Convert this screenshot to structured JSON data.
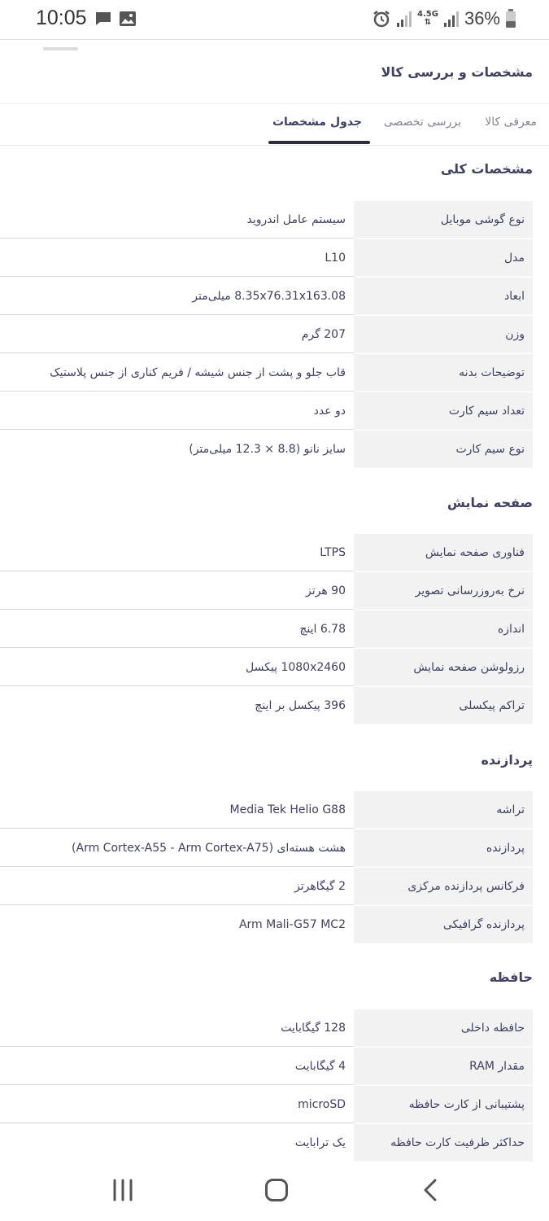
{
  "status_bar": {
    "time": "10:05",
    "network": "4.5G",
    "battery": "36%",
    "icons": [
      "message-icon",
      "image-icon",
      "alarm-icon",
      "wifi-signal-icon",
      "cell-signal-icon",
      "battery-icon"
    ]
  },
  "header": {
    "title": "مشخصات و بررسی کالا"
  },
  "tabs": [
    {
      "label": "معرفی کالا"
    },
    {
      "label": "بررسی تخصصی"
    },
    {
      "label": "جدول مشخصات"
    }
  ],
  "sections": [
    {
      "title": "مشخصات کلی",
      "rows": [
        {
          "key": "نوع گوشی موبایل",
          "value": "سیستم عامل اندروید"
        },
        {
          "key": "مدل",
          "value": "L10"
        },
        {
          "key": "ابعاد",
          "value": "8.35x76.31x163.08 میلی‌متر"
        },
        {
          "key": "وزن",
          "value": "207 گرم"
        },
        {
          "key": "توضیحات بدنه",
          "value": "قاب جلو و پشت از جنس شیشه / فریم کناری از جنس پلاستیک"
        },
        {
          "key": "تعداد سیم کارت",
          "value": "دو عدد"
        },
        {
          "key": "نوع سیم کارت",
          "value": "سایز نانو (8.8 × 12.3 میلی‌متر)"
        }
      ]
    },
    {
      "title": "صفحه نمایش",
      "rows": [
        {
          "key": "فناوری صفحه نمایش",
          "value": "LTPS"
        },
        {
          "key": "نرخ به‌روزرسانی تصویر",
          "value": "90 هرتز"
        },
        {
          "key": "اندازه",
          "value": "6.78 اینچ"
        },
        {
          "key": "رزولوشن صفحه نمایش",
          "value": "1080x2460 پیکسل"
        },
        {
          "key": "تراکم پیکسلی",
          "value": "396 پیکسل بر اینچ"
        }
      ]
    },
    {
      "title": "پردازنده",
      "rows": [
        {
          "key": "تراشه",
          "value": "Media Tek Helio G88"
        },
        {
          "key": "پردازنده",
          "value": "هشت هسته‌ای (Arm Cortex-A55 - Arm Cortex-A75)"
        },
        {
          "key": "فرکانس پردازنده مرکزی",
          "value": "2 گیگاهرتز"
        },
        {
          "key": "پردازنده گرافیکی",
          "value": "Arm Mali-G57 MC2"
        }
      ]
    },
    {
      "title": "حافظه",
      "rows": [
        {
          "key": "حافظه داخلی",
          "value": "128 گیگابایت"
        },
        {
          "key": "مقدار RAM",
          "value": "4 گیگابایت"
        },
        {
          "key": "پشتیبانی از کارت حافظه",
          "value": "microSD"
        },
        {
          "key": "حداکثر ظرفیت کارت حافظه",
          "value": "یک ترابایت"
        }
      ]
    }
  ],
  "nav_bar": {
    "icons": [
      "recent-apps-icon",
      "home-icon",
      "back-icon"
    ]
  }
}
